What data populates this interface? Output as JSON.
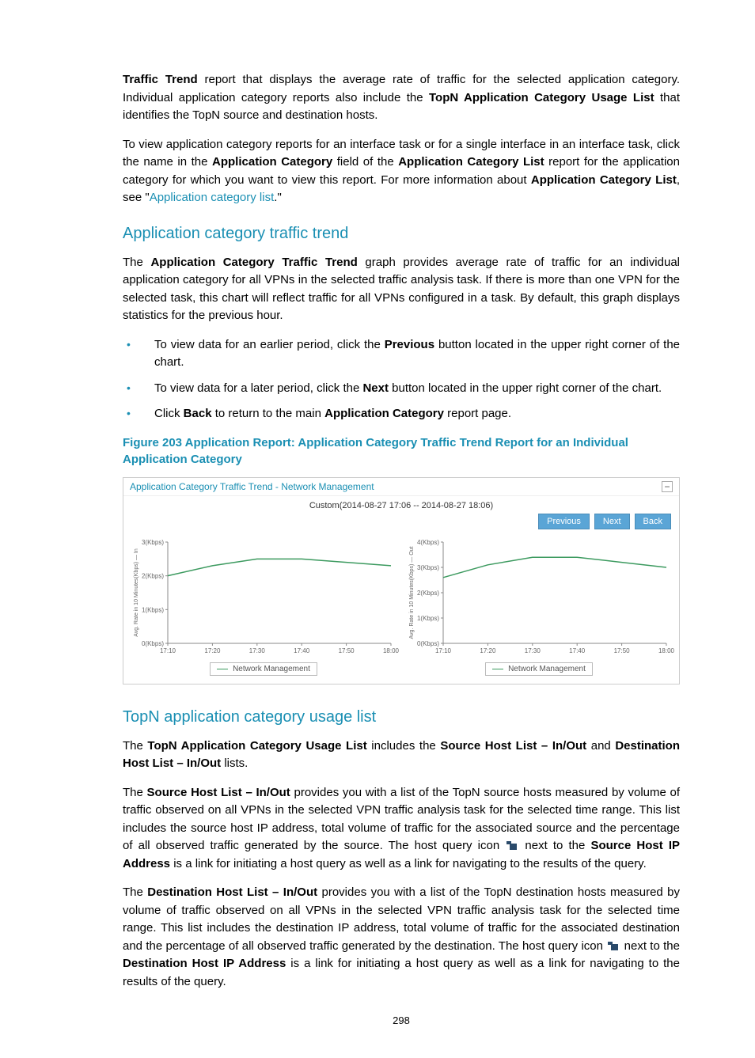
{
  "para1": {
    "b1": "Traffic Trend",
    "t1": " report that displays the average rate of traffic for the selected application category. Individual application category reports also include the ",
    "b2": "TopN Application Category Usage List",
    "t2": " that identifies the TopN source and destination hosts."
  },
  "para2": {
    "t1": "To view application category reports for an interface task or for a single interface in an interface task, click the name in the ",
    "b1": "Application Category",
    "t2": " field of the ",
    "b2": "Application Category List",
    "t3": " report for the application category for which you want to view this report. For more information about ",
    "b3": "Application Category List",
    "t4": ", see \"",
    "link": "Application category list",
    "t5": ".\""
  },
  "heading1": "Application category traffic trend",
  "para3": {
    "t1": "The ",
    "b1": "Application Category Traffic Trend",
    "t2": " graph provides average rate of traffic for an individual application category for all VPNs in the selected traffic analysis task. If there is more than one VPN for the selected task, this chart will reflect traffic for all VPNs configured in a task. By default, this graph displays statistics for the previous hour."
  },
  "bullets": [
    {
      "t1": "To view data for an earlier period, click the ",
      "b": "Previous",
      "t2": " button located in the upper right corner of the chart."
    },
    {
      "t1": "To view data for a later period, click the ",
      "b": "Next",
      "t2": " button located in the upper right corner of the chart."
    },
    {
      "t1": "Click ",
      "b": "Back",
      "t2": " to return to the main ",
      "b2": "Application Category",
      "t3": " report page."
    }
  ],
  "figcaption": "Figure 203 Application Report: Application Category Traffic Trend Report for an Individual Application Category",
  "chart": {
    "panel_title": "Application Category Traffic Trend - Network Management",
    "subtitle": "Custom(2014-08-27 17:06 -- 2014-08-27 18:06)",
    "buttons": {
      "prev": "Previous",
      "next": "Next",
      "back": "Back"
    },
    "legend": "Network Management"
  },
  "chart_data": [
    {
      "type": "line",
      "title": "In",
      "ylabel": "Avg. Rate in 10 Minutes(Kbps) — In",
      "x_ticks": [
        "17:10",
        "17:20",
        "17:30",
        "17:40",
        "17:50",
        "18:00"
      ],
      "y_ticks": [
        "0(Kbps)",
        "1(Kbps)",
        "2(Kbps)",
        "3(Kbps)"
      ],
      "ylim": [
        0,
        3
      ],
      "series": [
        {
          "name": "Network Management",
          "color": "#3c9a5f",
          "values": [
            2.0,
            2.3,
            2.5,
            2.5,
            2.4,
            2.3
          ]
        }
      ]
    },
    {
      "type": "line",
      "title": "Out",
      "ylabel": "Avg. Rate in 10 Minutes(Kbps) — Out",
      "x_ticks": [
        "17:10",
        "17:20",
        "17:30",
        "17:40",
        "17:50",
        "18:00"
      ],
      "y_ticks": [
        "0(Kbps)",
        "1(Kbps)",
        "2(Kbps)",
        "3(Kbps)",
        "4(Kbps)"
      ],
      "ylim": [
        0,
        4
      ],
      "series": [
        {
          "name": "Network Management",
          "color": "#3c9a5f",
          "values": [
            2.6,
            3.1,
            3.4,
            3.4,
            3.2,
            3.0
          ]
        }
      ]
    }
  ],
  "heading2": "TopN application category usage list",
  "para4": {
    "t1": "The ",
    "b1": "TopN Application Category Usage List",
    "t2": " includes the ",
    "b2": "Source Host List – In/Out",
    "t3": " and ",
    "b3": "Destination Host List – In/Out",
    "t4": " lists."
  },
  "para5": {
    "t1": "The ",
    "b1": "Source Host List – In/Out",
    "t2": " provides you with a list of the TopN source hosts measured by volume of traffic observed on all VPNs in the selected VPN traffic analysis task for the selected time range. This list includes the source host IP address, total volume of traffic for the associated source and the percentage of all observed traffic generated by the source. The host query icon ",
    "t3": " next to the ",
    "b2": "Source Host IP Address",
    "t4": " is a link for initiating a host query as well as a link for navigating to the results of the query."
  },
  "para6": {
    "t1": "The ",
    "b1": "Destination Host List – In/Out",
    "t2": " provides you with a list of the TopN destination hosts measured by volume of traffic observed on all VPNs in the selected VPN traffic analysis task for the selected time range. This list includes the destination IP address, total volume of traffic for the associated destination and the percentage of all observed traffic generated by the destination. The host query icon ",
    "t3": " next to the ",
    "b2": "Destination Host IP Address",
    "t4": " is a link for initiating a host query as well as a link for navigating to the results of the query."
  },
  "pagenum": "298"
}
